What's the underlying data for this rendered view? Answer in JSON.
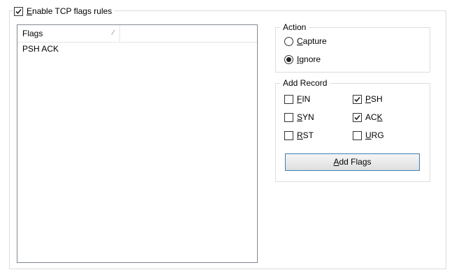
{
  "enable_rules": {
    "label_hotkey": "E",
    "label_rest": "nable TCP flags rules",
    "checked": true
  },
  "flags_list": {
    "column_header": "Flags",
    "rows": [
      "PSH ACK"
    ]
  },
  "action_group": {
    "title": "Action",
    "options": [
      {
        "hotkey": "C",
        "rest": "apture",
        "selected": false
      },
      {
        "hotkey": "I",
        "rest": "gnore",
        "selected": true
      }
    ]
  },
  "add_record_group": {
    "title": "Add Record",
    "flags": {
      "fin": {
        "hotkey": "F",
        "rest": "IN",
        "checked": false
      },
      "syn": {
        "hotkey": "S",
        "rest": "YN",
        "checked": false
      },
      "rst": {
        "hotkey": "R",
        "rest": "ST",
        "checked": false
      },
      "psh": {
        "hotkey": "P",
        "rest": "SH",
        "checked": true
      },
      "ack_pre": "AC",
      "ack_hotkey": "K",
      "ack_checked": true,
      "urg": {
        "hotkey": "U",
        "rest": "RG",
        "checked": false
      }
    },
    "button_hotkey": "A",
    "button_rest": "dd Flags"
  },
  "colors": {
    "button_border": "#3c7fb1",
    "list_border": "#828790",
    "group_border": "#dcdcdc"
  }
}
